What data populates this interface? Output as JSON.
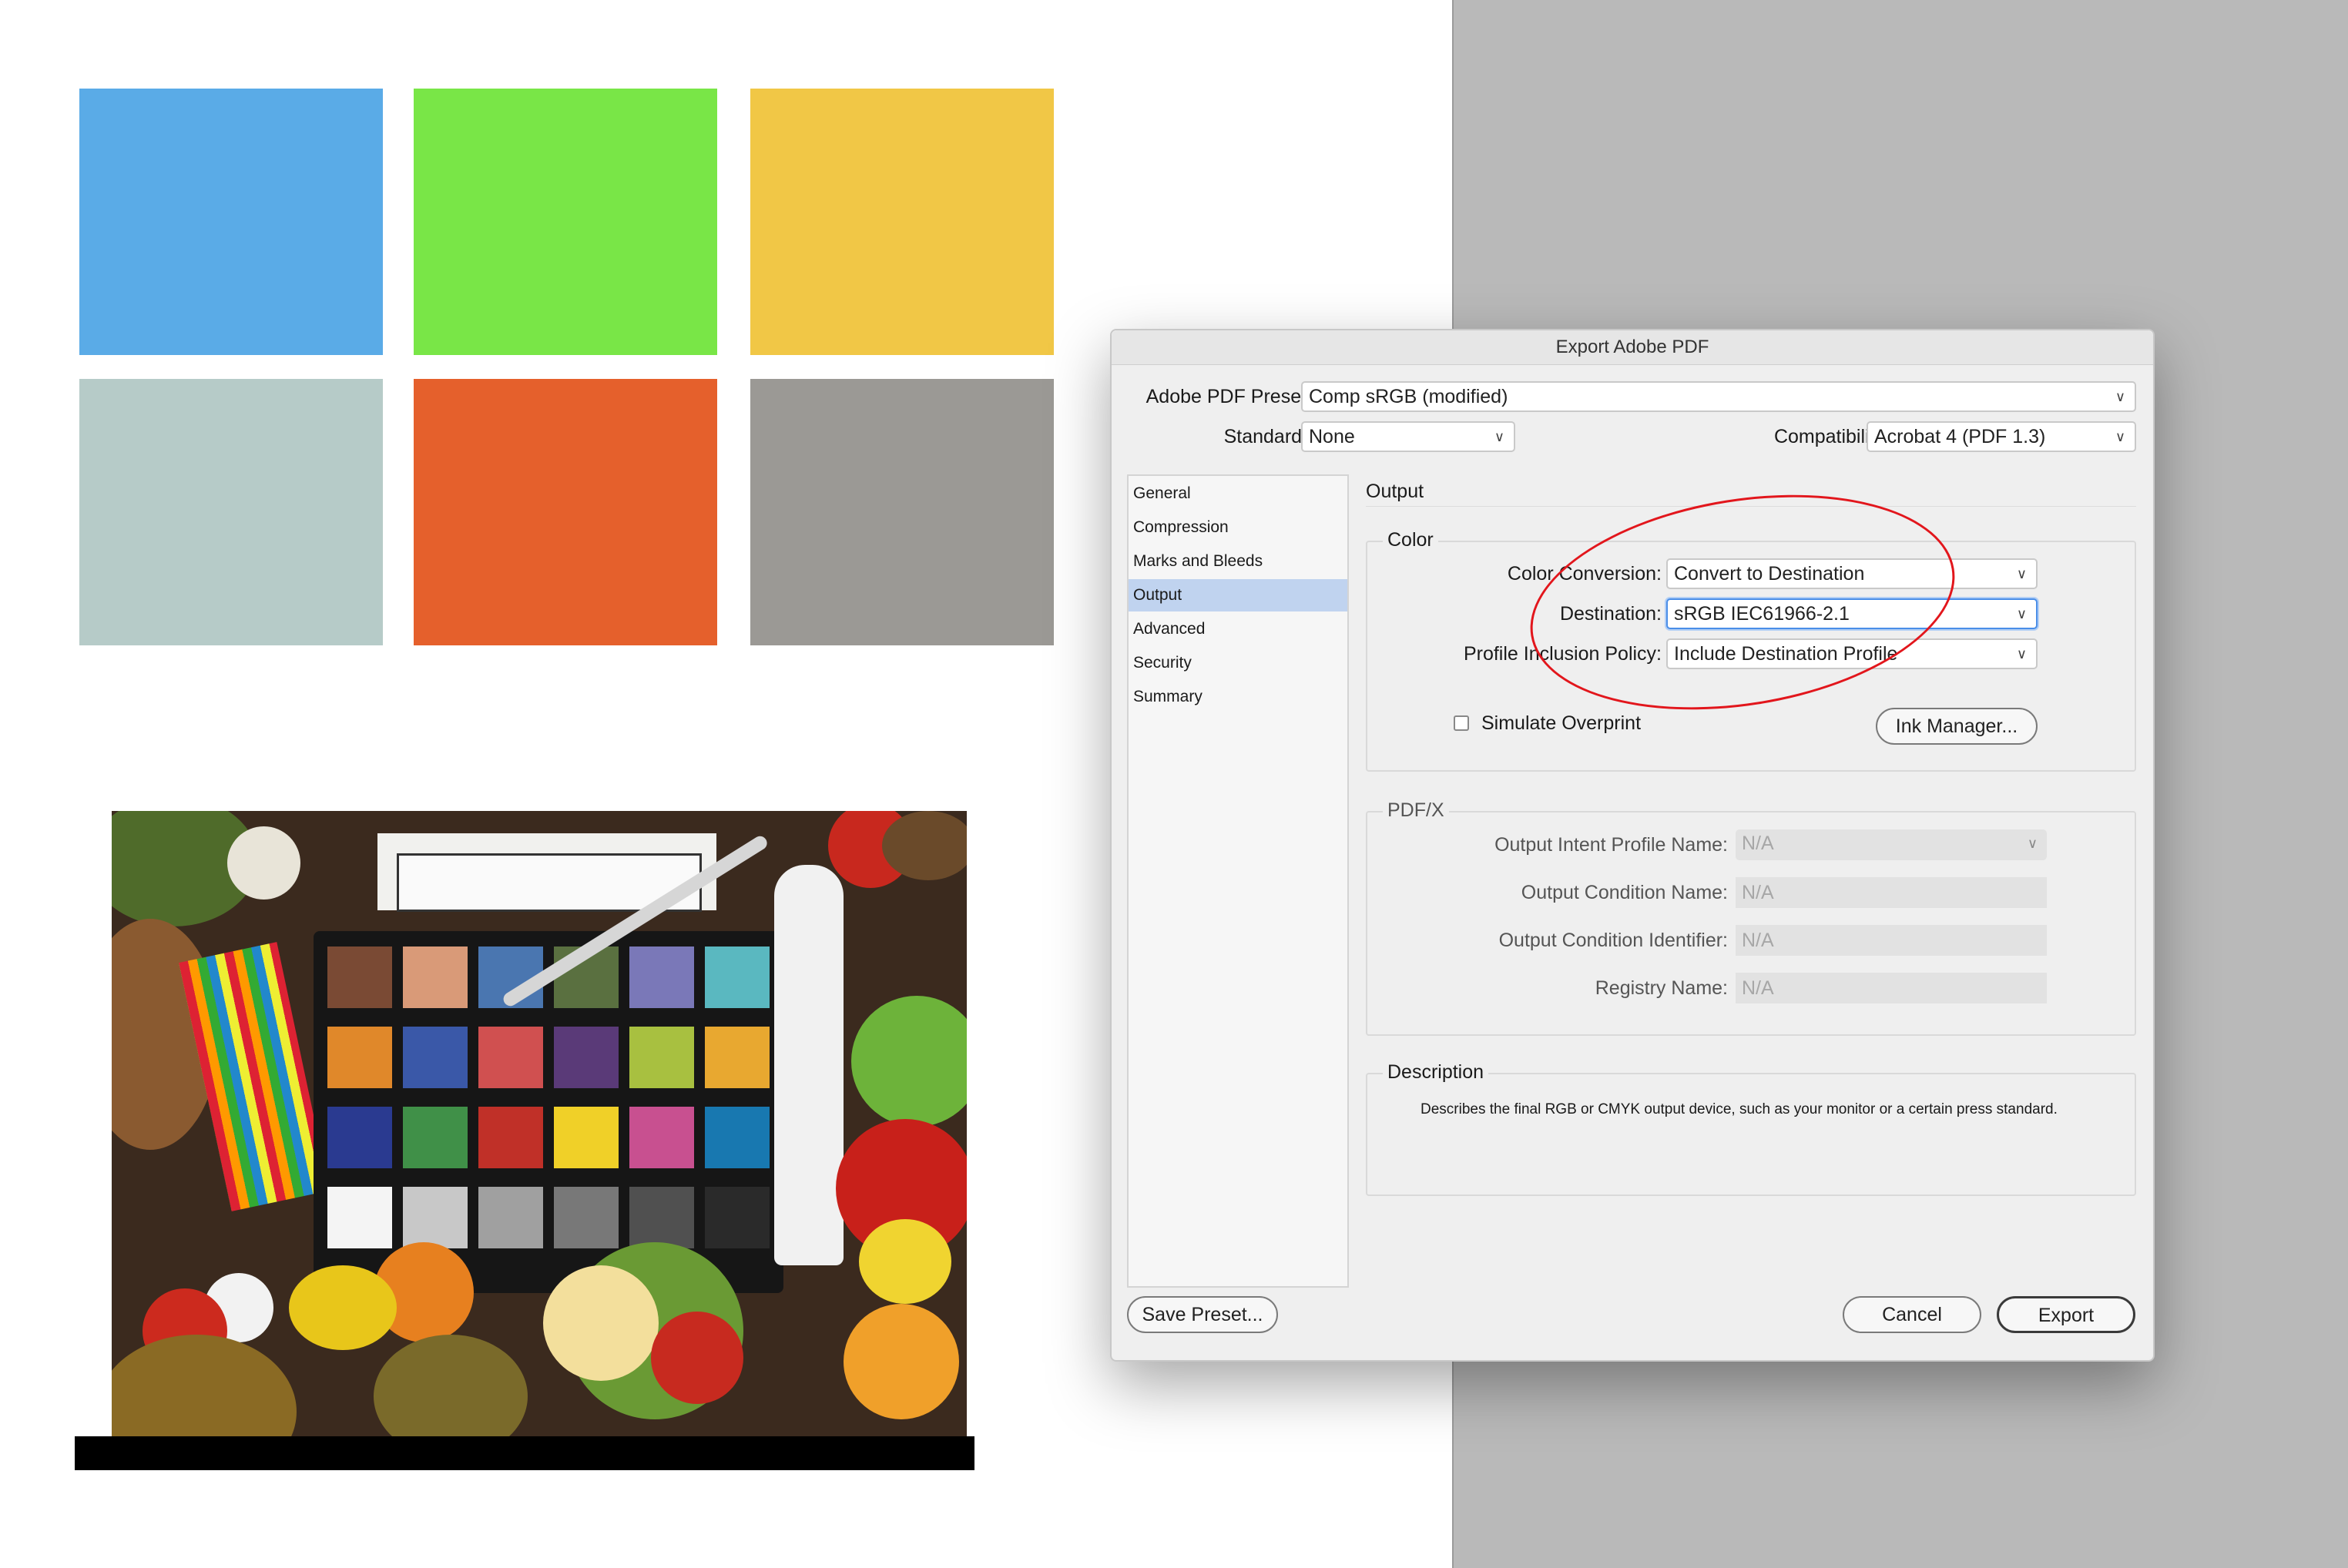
{
  "swatches": [
    "#5aabe7",
    "#79e647",
    "#f1c746",
    "#b6cbc8",
    "#e5602c",
    "#9b9995"
  ],
  "dialog": {
    "title": "Export Adobe PDF",
    "preset_label": "Adobe PDF Preset:",
    "preset_value": "Comp sRGB (modified)",
    "standard_label": "Standard:",
    "standard_value": "None",
    "compat_label": "Compatibility:",
    "compat_value": "Acrobat 4 (PDF 1.3)",
    "sidebar": [
      "General",
      "Compression",
      "Marks and Bleeds",
      "Output",
      "Advanced",
      "Security",
      "Summary"
    ],
    "selected_index": 3,
    "panel_title": "Output",
    "color": {
      "group_title": "Color",
      "conversion_label": "Color Conversion:",
      "conversion_value": "Convert to Destination",
      "destination_label": "Destination:",
      "destination_value": "sRGB IEC61966-2.1",
      "policy_label": "Profile Inclusion Policy:",
      "policy_value": "Include Destination Profile",
      "simulate_label": "Simulate Overprint",
      "ink_manager": "Ink Manager..."
    },
    "pdfx": {
      "group_title": "PDF/X",
      "intent_label": "Output Intent Profile Name:",
      "intent_value": "N/A",
      "condition_label": "Output Condition Name:",
      "condition_value": "N/A",
      "identifier_label": "Output Condition Identifier:",
      "identifier_value": "N/A",
      "registry_label": "Registry Name:",
      "registry_value": "N/A"
    },
    "description": {
      "group_title": "Description",
      "text": "Describes the final RGB or CMYK output device, such as your monitor or a certain press standard."
    },
    "save_preset": "Save Preset...",
    "cancel": "Cancel",
    "export": "Export"
  },
  "colors": {
    "highlight_ellipse": "#e2161c",
    "sidebar_selected": "#c0d3ef",
    "focus_ring": "#4a8ee8"
  }
}
